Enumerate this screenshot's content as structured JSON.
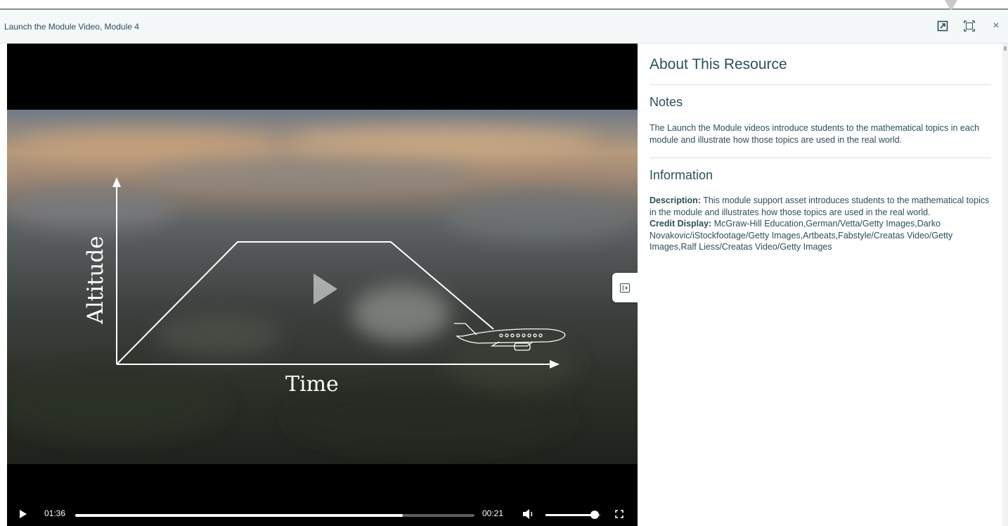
{
  "window": {
    "title": "Launch the Module Video, Module 4",
    "buttons": {
      "open_new_window_icon": "external-link-icon",
      "fullscreen_icon": "expand-icon",
      "close_label": "×"
    }
  },
  "video": {
    "illustration": {
      "y_axis_label": "Altitude",
      "x_axis_label": "Time"
    },
    "controls": {
      "elapsed": "01:36",
      "remaining": "00:21",
      "progress_fraction": 0.82,
      "volume_fraction": 0.9
    }
  },
  "panel": {
    "heading": "About This Resource",
    "notes": {
      "heading": "Notes",
      "text": "The Launch the Module videos introduce students to the mathematical topics in each module and illustrate how those topics are used in the real world."
    },
    "information": {
      "heading": "Information",
      "description_label": "Description:",
      "description_text": "This module support asset introduces students to the mathematical topics in the module and illustrates how those topics are used in the real world.",
      "credit_label": "Credit Display:",
      "credit_text": "McGraw-Hill Education,German/Vetta/Getty Images,Darko Novakovic/iStockfootage/Getty Images,Artbeats,Fabstyle/Creatas Video/Getty Images,Ralf Liess/Creatas Video/Getty Images"
    }
  },
  "colors": {
    "text": "#2d4f5c",
    "titlebar_bg": "#f4f8f8",
    "player_bg": "#000000"
  }
}
